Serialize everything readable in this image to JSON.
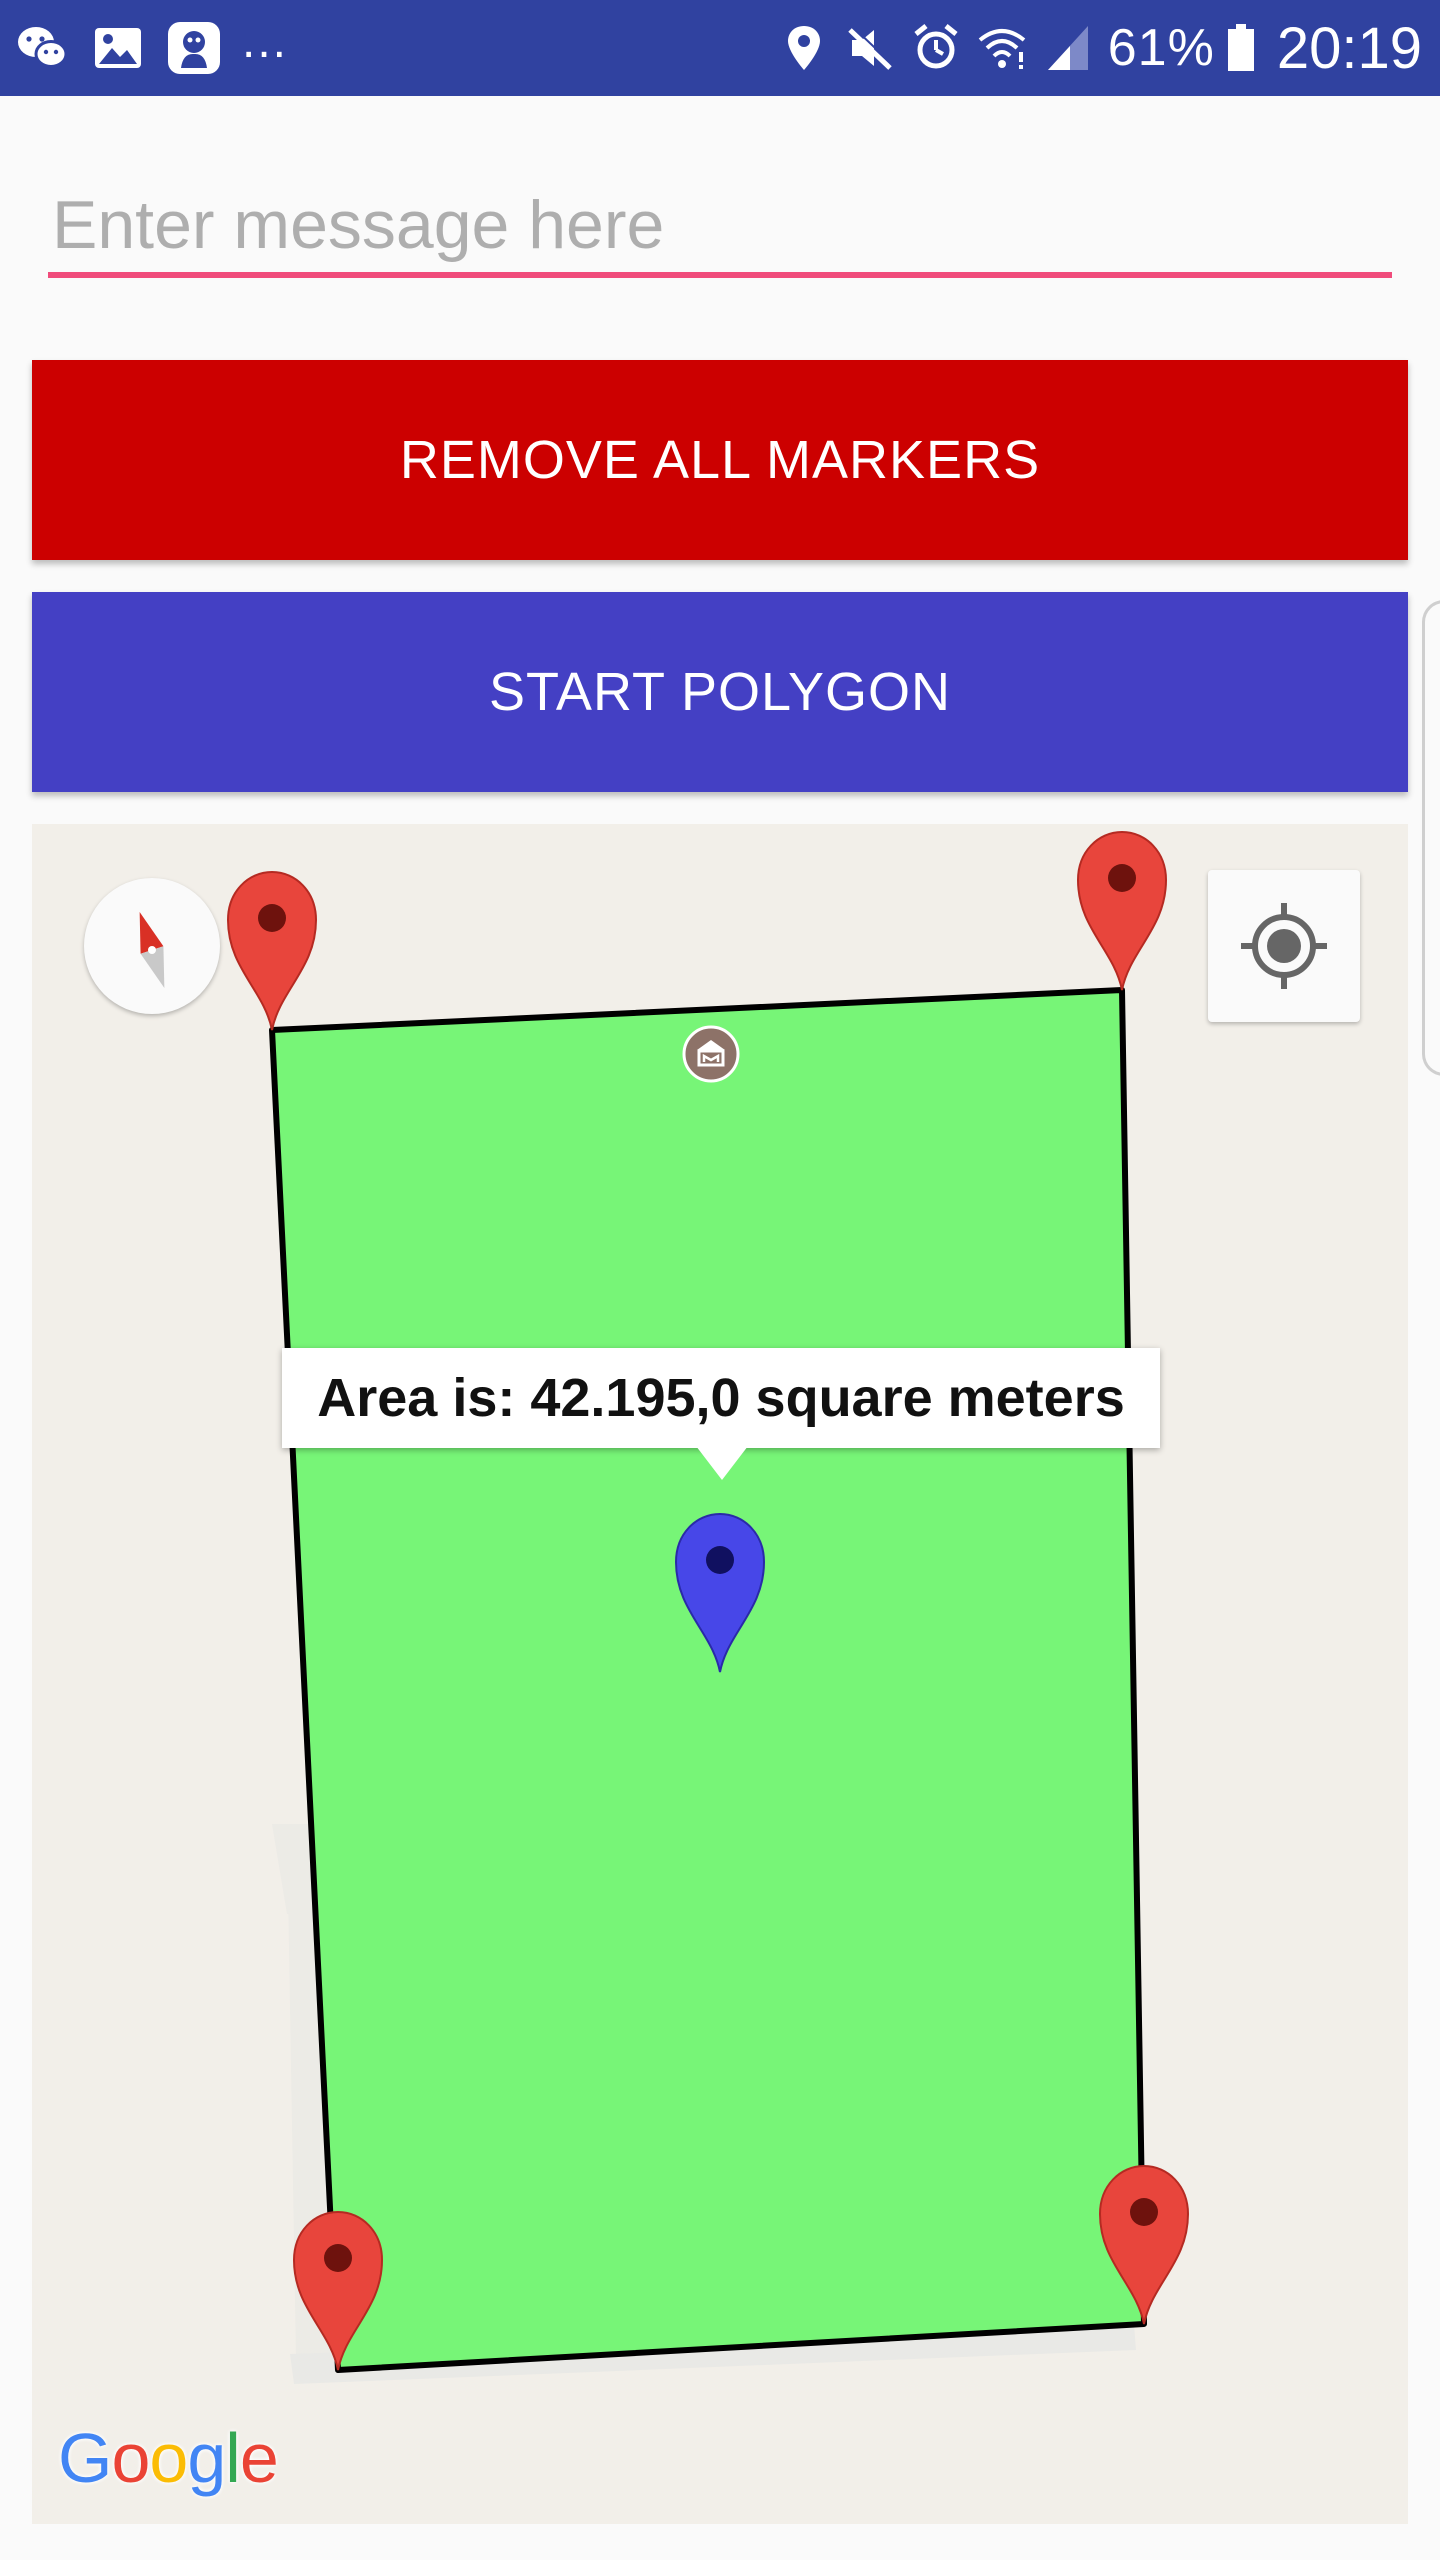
{
  "status_bar": {
    "overflow": "...",
    "battery_percent": "61%",
    "time": "20:19",
    "icons_left": [
      "wechat-icon",
      "gallery-icon",
      "app-notification-icon"
    ],
    "icons_right": [
      "location-icon",
      "mute-icon",
      "alarm-icon",
      "wifi-icon",
      "signal-icon",
      "battery-icon"
    ],
    "background_color": "#3042a0"
  },
  "message_input": {
    "placeholder": "Enter message here",
    "value": "",
    "underline_color": "#f04b7b"
  },
  "buttons": {
    "remove_all_markers": {
      "label": "REMOVE ALL MARKERS",
      "color": "#cc0000"
    },
    "start_polygon": {
      "label": "START POLYGON",
      "color": "#4440c4"
    }
  },
  "map": {
    "info_window": {
      "text": "Area is: 42.195,0 square meters"
    },
    "polygon": {
      "fill_color": "#77f577",
      "stroke_color": "#000000"
    },
    "markers": {
      "vertex_color": "#e8453c",
      "center_color": "#4747e8",
      "vertex_count": 4
    },
    "attribution": {
      "letters": [
        {
          "char": "G",
          "color": "#4285f4"
        },
        {
          "char": "o",
          "color": "#ea4335"
        },
        {
          "char": "o",
          "color": "#fbbc05"
        },
        {
          "char": "g",
          "color": "#4285f4"
        },
        {
          "char": "l",
          "color": "#34a853"
        },
        {
          "char": "e",
          "color": "#ea4335"
        }
      ]
    },
    "controls": [
      "compass-icon",
      "my-location-icon"
    ]
  }
}
